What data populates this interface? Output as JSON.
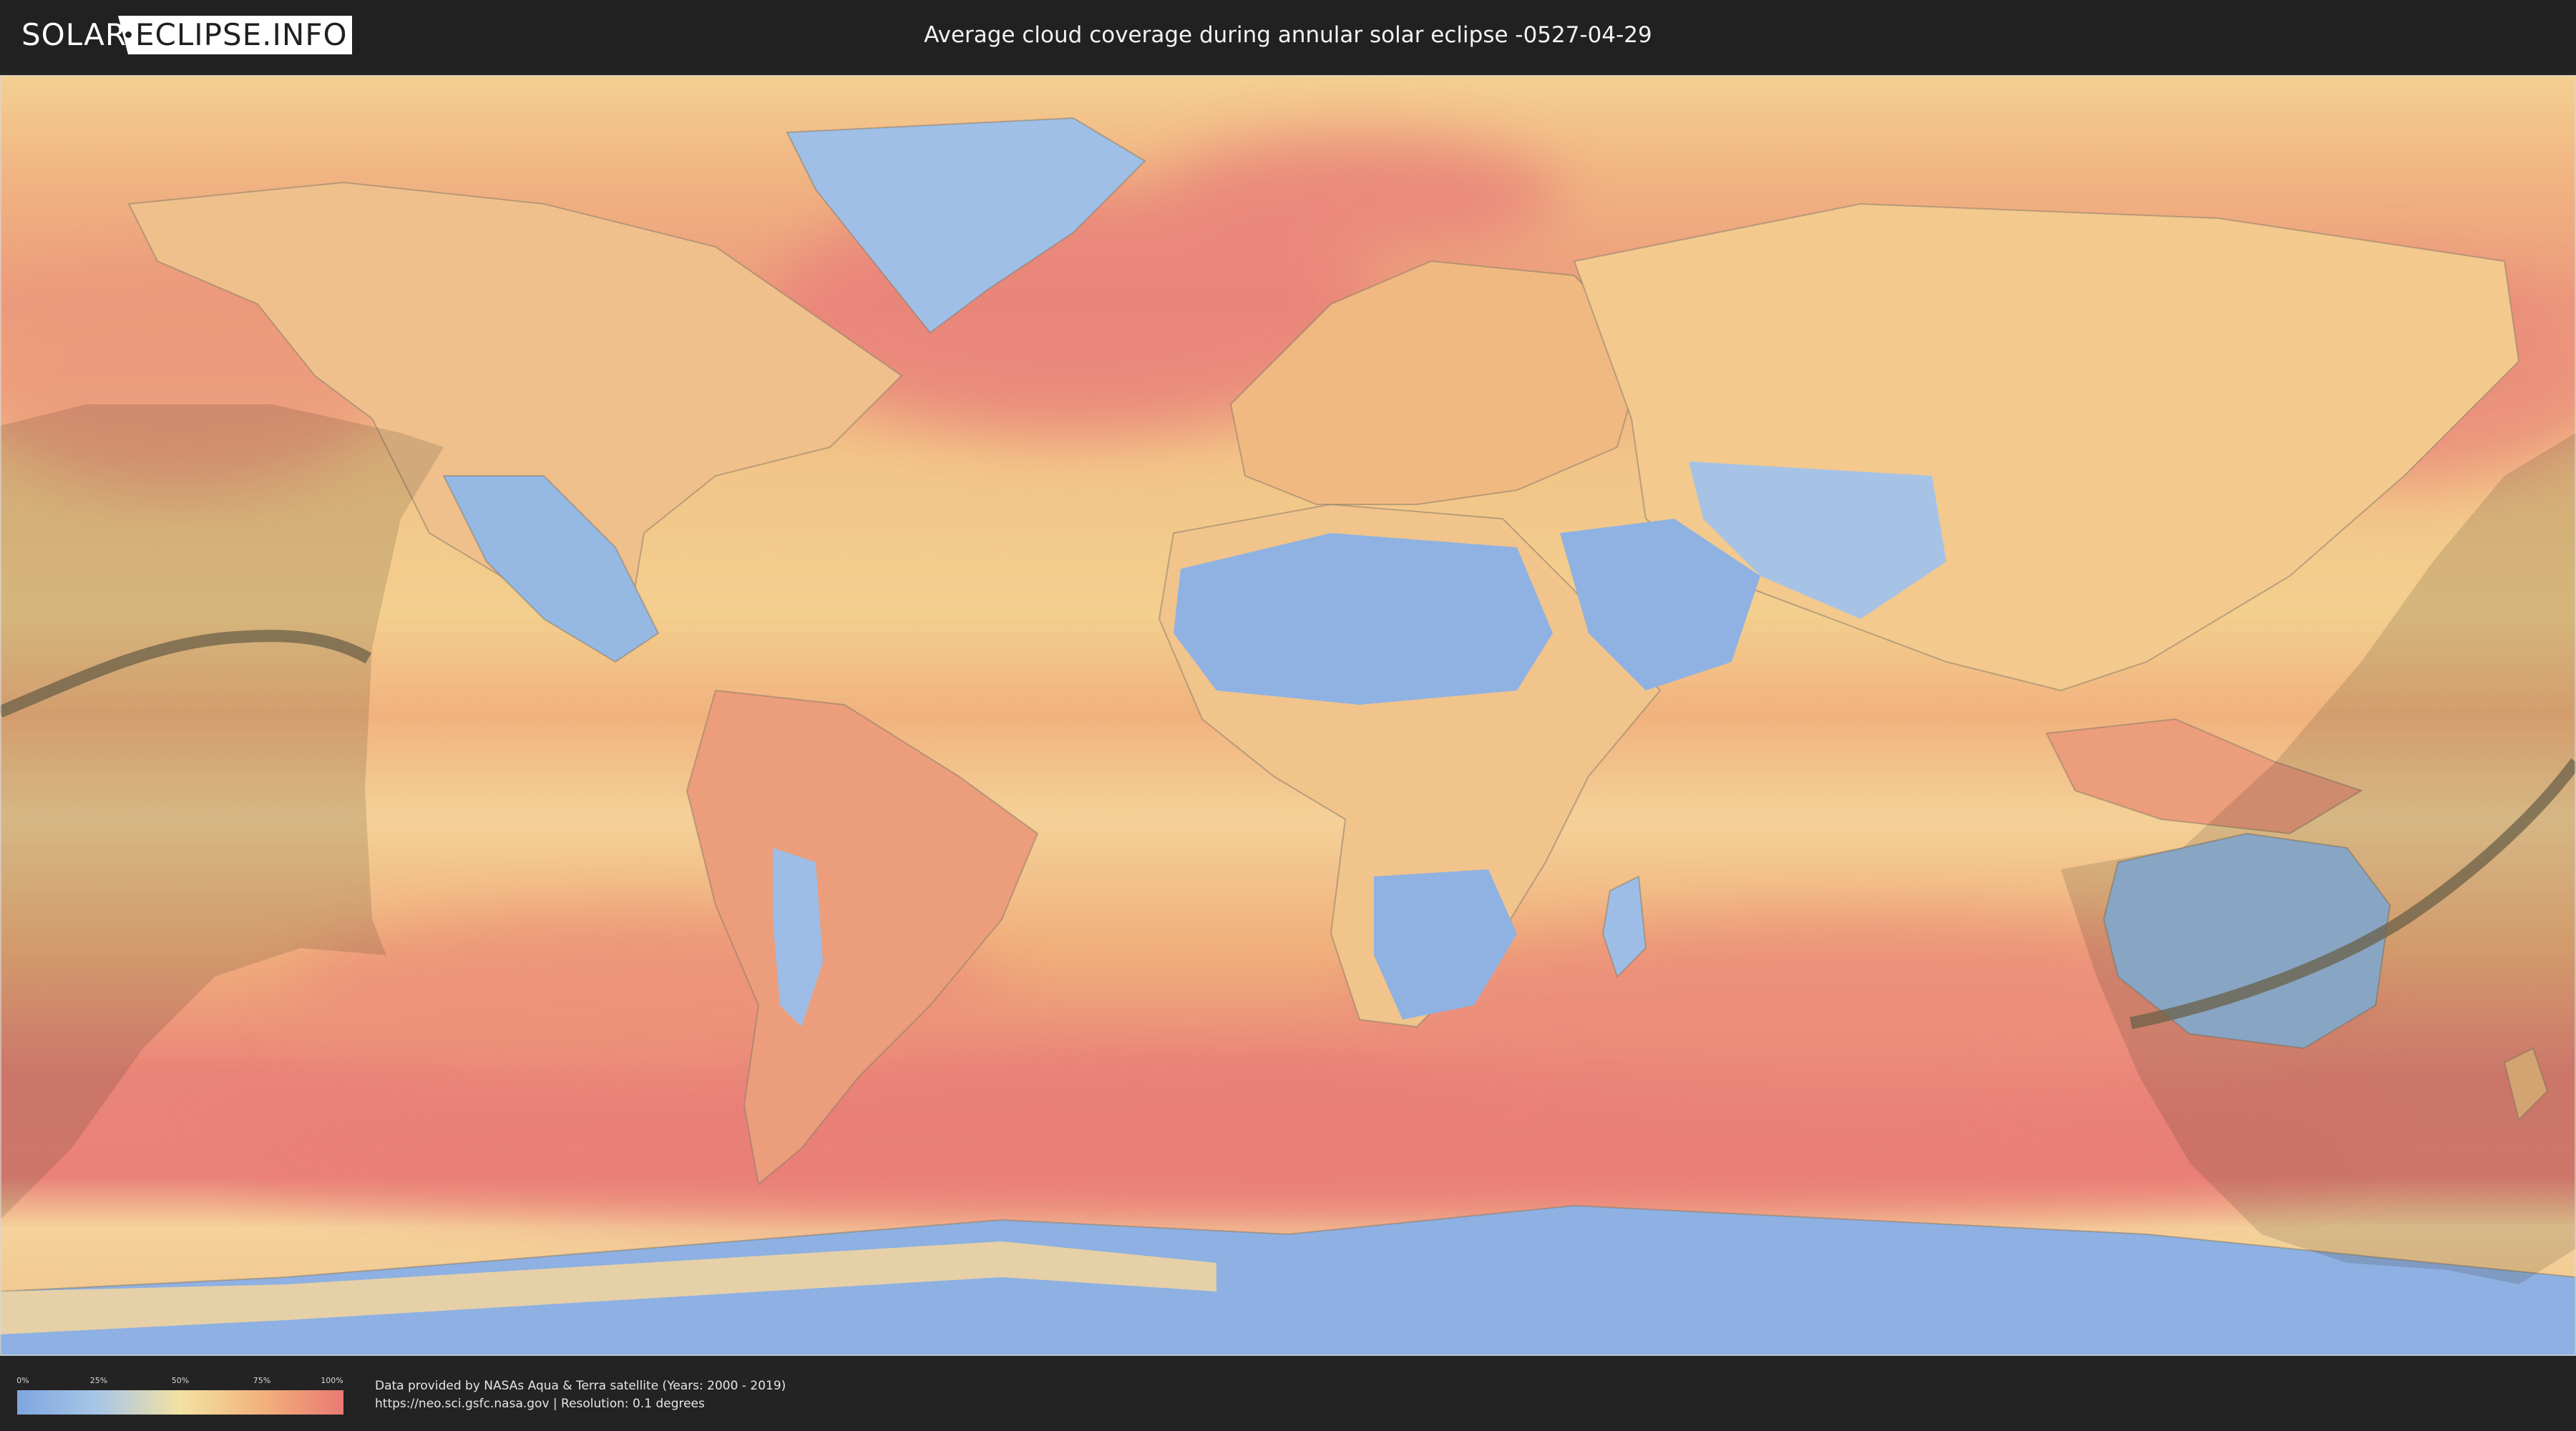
{
  "header": {
    "logo_left": "SOLAR",
    "logo_right": "ECLIPSE.INFO",
    "title": "Average cloud coverage during annular solar eclipse -0527-04-29"
  },
  "map": {
    "projection": "equirectangular",
    "layer": "average cloud coverage",
    "path_color": "#6b6048",
    "shading_color": "#3a3020"
  },
  "legend": {
    "ticks": [
      "0%",
      "25%",
      "50%",
      "75%",
      "100%"
    ],
    "colors": [
      "#7ea6e0",
      "#a9c6e6",
      "#f3e2a2",
      "#f2b27c",
      "#e97a72"
    ]
  },
  "footer": {
    "attribution_line1": "Data provided by NASAs Aqua & Terra satellite (Years: 2000 - 2019)",
    "attribution_line2": "https://neo.sci.gsfc.nasa.gov | Resolution: 0.1 degrees"
  }
}
